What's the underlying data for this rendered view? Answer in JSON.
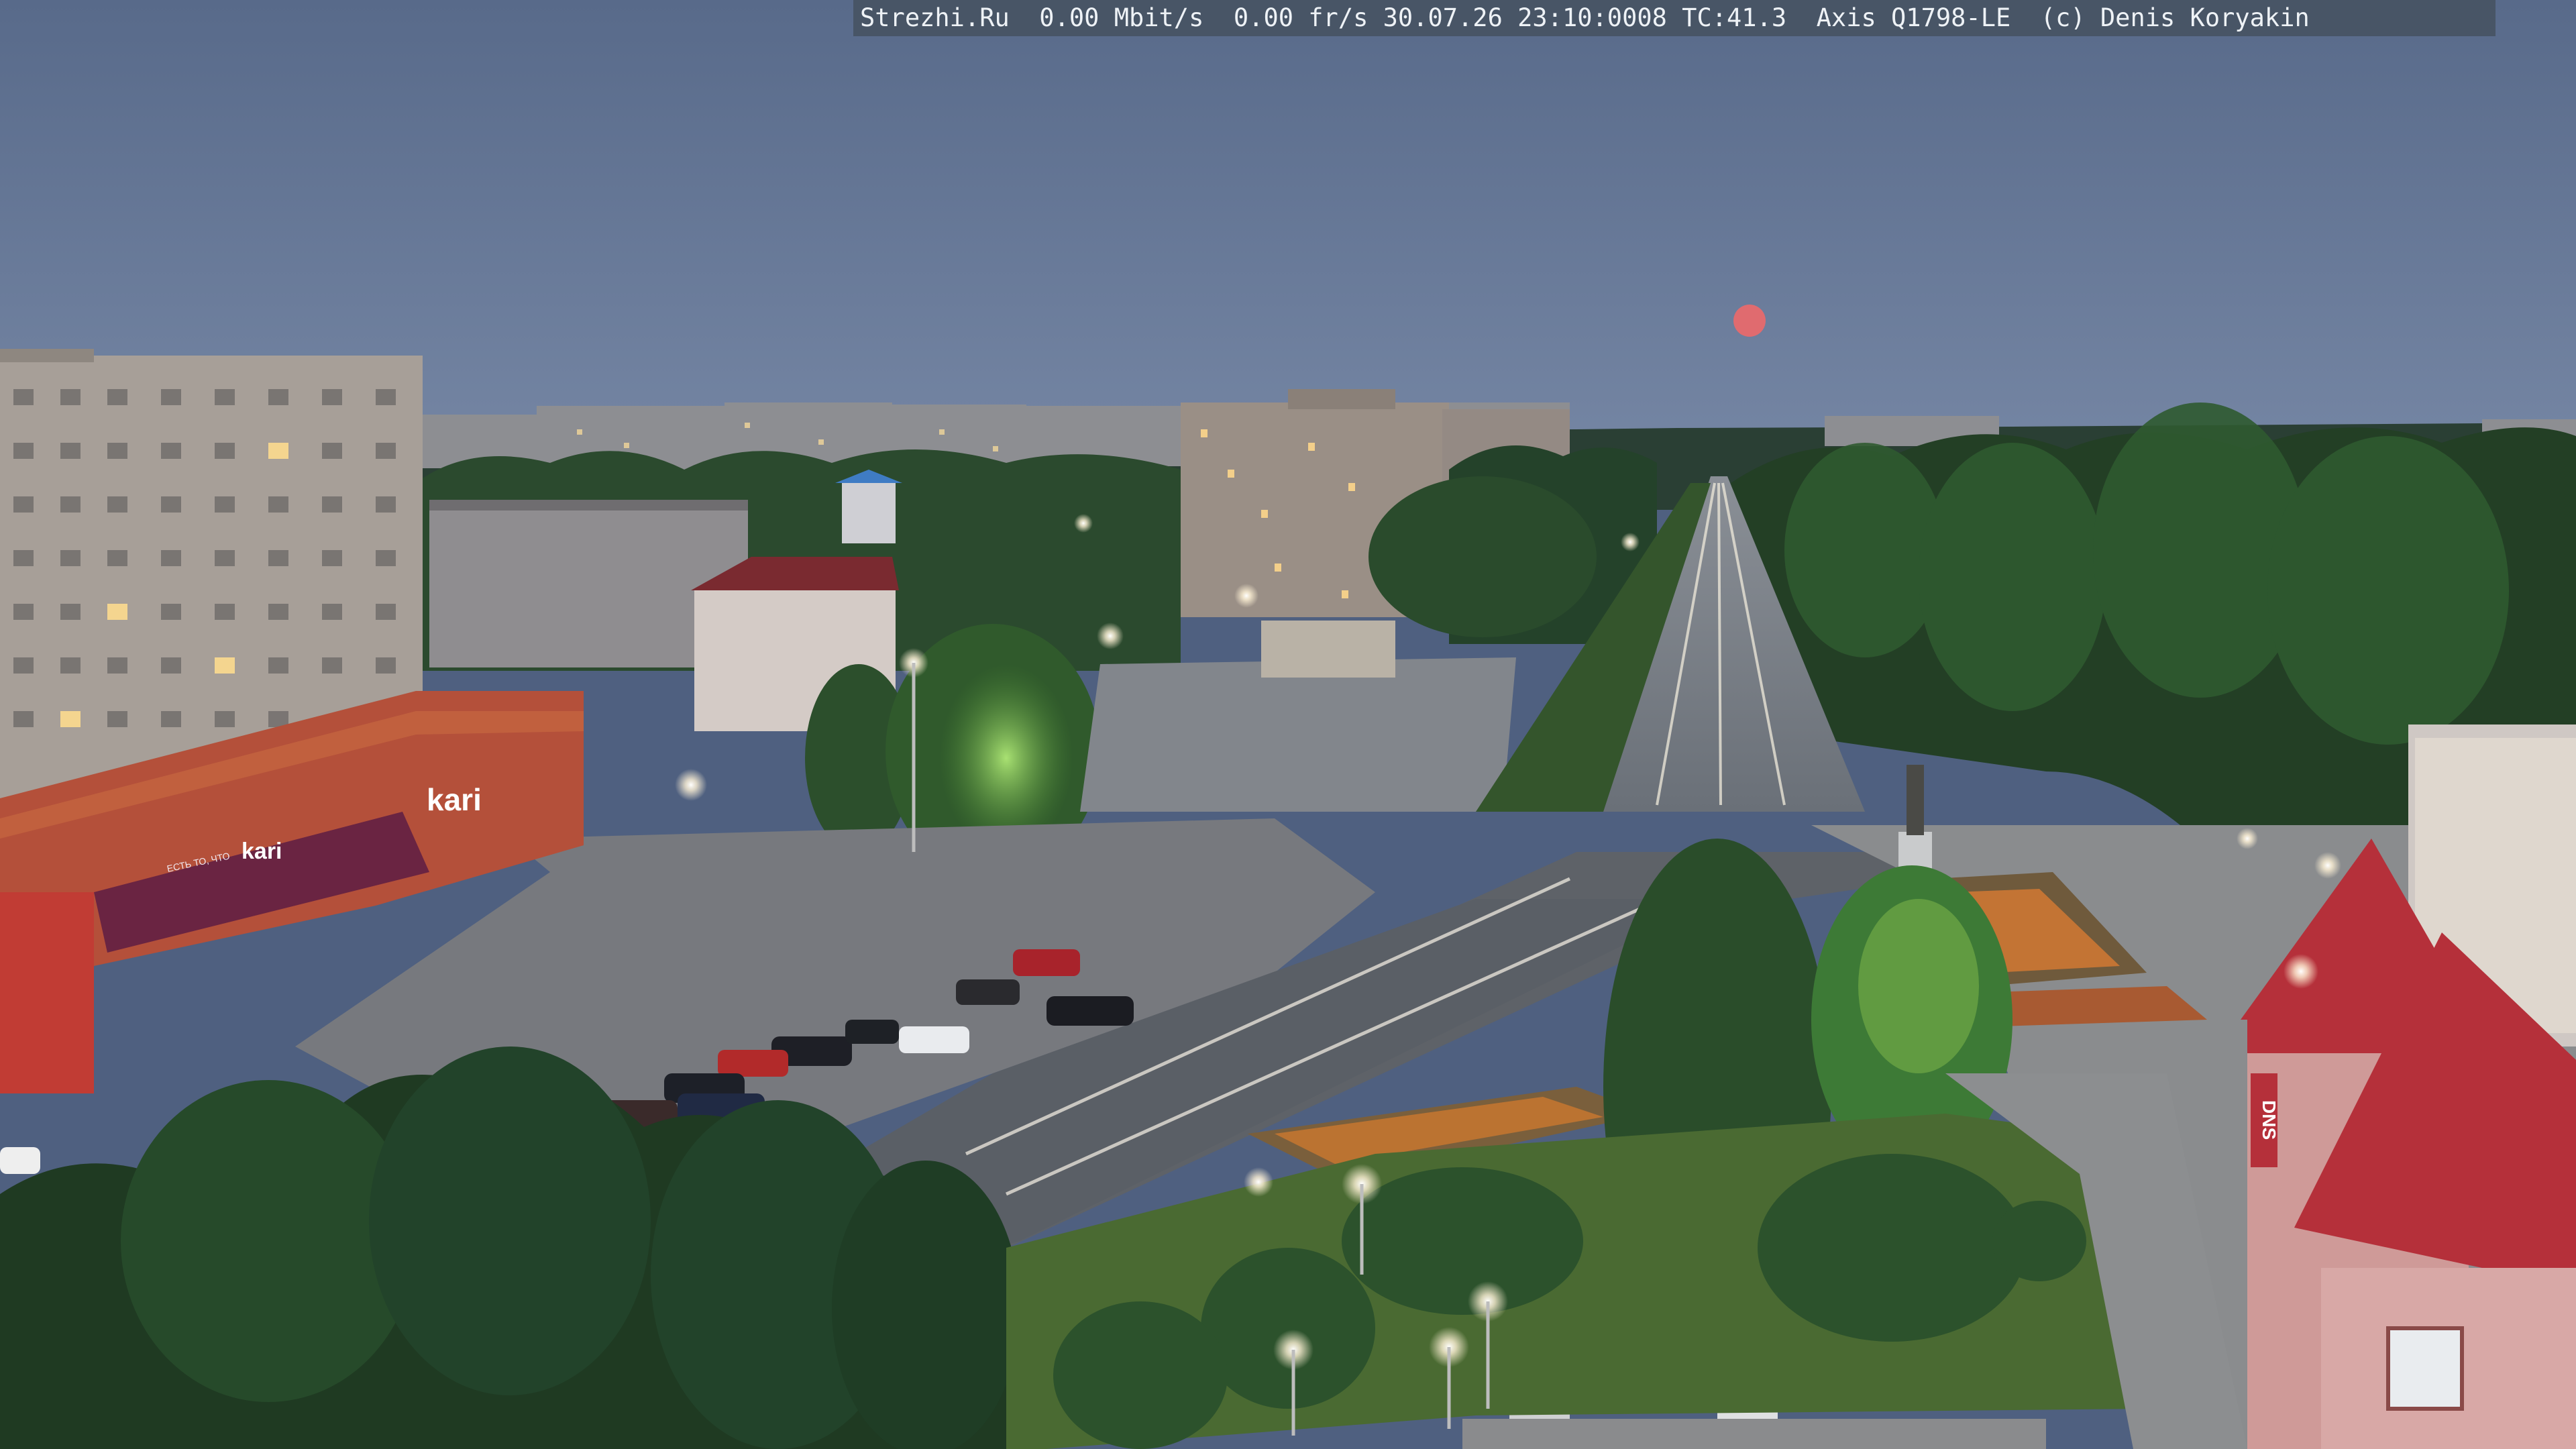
{
  "overlay": {
    "text": "Strezhi.Ru  0.00 Mbit/s  0.00 fr/s 30.07.26 23:10:0008 TC:41.3  Axis Q1798-LE  (c) Denis Koryakin"
  },
  "signs": {
    "store_brand": "kari",
    "store_brand_small": "kari",
    "store_slogan": "ЕСТЬ ТО, ЧТО",
    "dns": "DNS"
  },
  "colors": {
    "sky_top": "#5d6e8c",
    "sky_horizon": "#7081a0",
    "moon": "#e06b6f",
    "tree_dark": "#1f3a22",
    "tree_mid": "#2f5a30",
    "road": "#5a6068",
    "roof_red": "#b5303a"
  }
}
